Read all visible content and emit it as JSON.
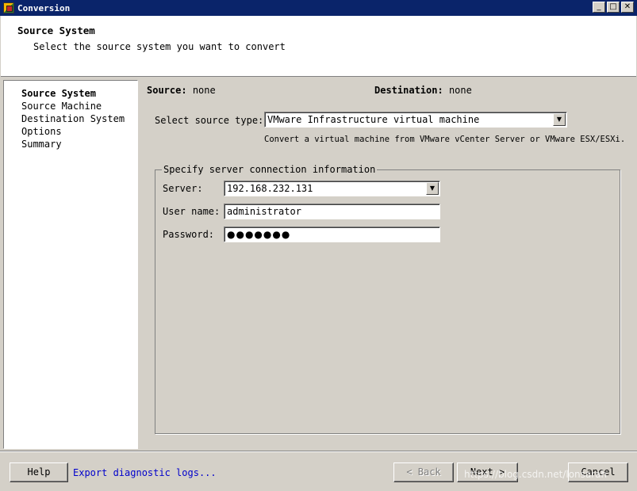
{
  "window": {
    "title": "Conversion",
    "icon": "vmware-converter-icon",
    "minimize_icon": "_",
    "maximize_icon": "□",
    "close_icon": "✕"
  },
  "header": {
    "title": "Source System",
    "subtitle": "Select the source system you want to convert"
  },
  "sidebar": {
    "items": [
      {
        "label": "Source System",
        "active": true
      },
      {
        "label": "Source Machine",
        "active": false
      },
      {
        "label": "Destination System",
        "active": false
      },
      {
        "label": "Options",
        "active": false
      },
      {
        "label": "Summary",
        "active": false
      }
    ]
  },
  "main": {
    "source_label": "Source:",
    "source_value": "none",
    "destination_label": "Destination:",
    "destination_value": "none",
    "source_type_label": "Select source type:",
    "source_type_value": "VMware Infrastructure virtual machine",
    "source_type_description": "Convert a virtual machine from VMware vCenter Server or VMware ESX/ESXi.",
    "group_title": "Specify server connection information",
    "server_label": "Server:",
    "server_value": "192.168.232.131",
    "username_label": "User name:",
    "username_value": "administrator",
    "password_label": "Password:",
    "password_value": "●●●●●●●"
  },
  "footer": {
    "help_label": "Help",
    "export_logs_label": "Export diagnostic logs...",
    "back_label": "< Back",
    "next_label": "Next >",
    "cancel_label": "Cancel",
    "watermark": "https://blog.csdn.net/lonsarah"
  },
  "colors": {
    "titlebar": "#0a246a",
    "window_bg": "#d4d0c8",
    "link": "#0000cc"
  }
}
